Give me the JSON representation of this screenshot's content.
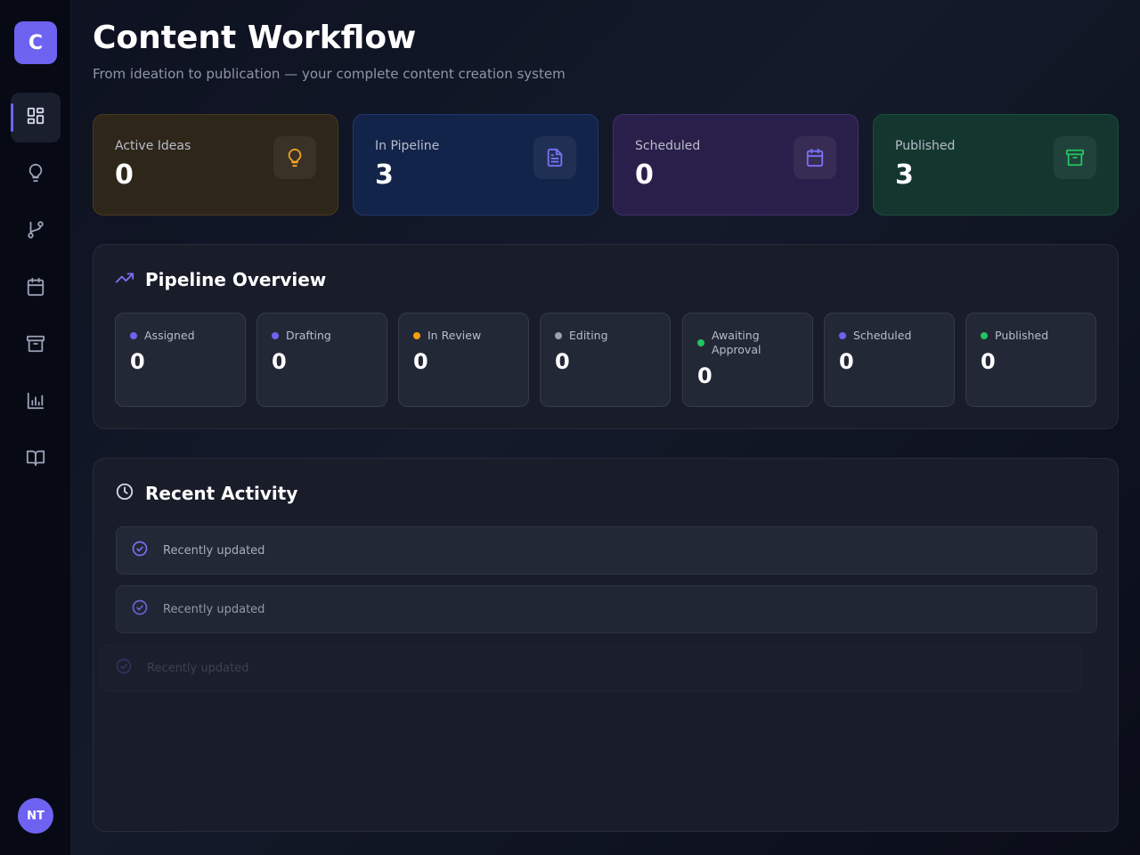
{
  "sidebar": {
    "logo": "C",
    "items": [
      {
        "name": "dashboard",
        "icon": "grid-icon",
        "active": true
      },
      {
        "name": "ideas",
        "icon": "lightbulb-icon"
      },
      {
        "name": "workflow",
        "icon": "git-branch-icon"
      },
      {
        "name": "calendar",
        "icon": "calendar-icon"
      },
      {
        "name": "archive",
        "icon": "archive-icon"
      },
      {
        "name": "analytics",
        "icon": "bar-chart-icon"
      },
      {
        "name": "library",
        "icon": "book-open-icon"
      }
    ],
    "avatar": "NT"
  },
  "header": {
    "title": "Content Workflow",
    "subtitle": "From ideation to publication — your complete content creation system"
  },
  "stats": [
    {
      "label": "Active Ideas",
      "value": "0",
      "icon": "lightbulb-icon",
      "color": "#f5a524"
    },
    {
      "label": "In Pipeline",
      "value": "3",
      "icon": "document-icon",
      "color": "#6e63f0"
    },
    {
      "label": "Scheduled",
      "value": "0",
      "icon": "calendar-icon",
      "color": "#6e63f0"
    },
    {
      "label": "Published",
      "value": "3",
      "icon": "archive-icon",
      "color": "#22c55e"
    }
  ],
  "pipeline": {
    "title": "Pipeline Overview",
    "stages": [
      {
        "label": "Assigned",
        "value": "0",
        "color": "#6e63f0"
      },
      {
        "label": "Drafting",
        "value": "0",
        "color": "#6e63f0"
      },
      {
        "label": "In Review",
        "value": "0",
        "color": "#f59e0b"
      },
      {
        "label": "Editing",
        "value": "0",
        "color": "#9ca3af"
      },
      {
        "label": "Awaiting Approval",
        "value": "0",
        "color": "#22c55e"
      },
      {
        "label": "Scheduled",
        "value": "0",
        "color": "#6e63f0"
      },
      {
        "label": "Published",
        "value": "0",
        "color": "#22c55e"
      }
    ]
  },
  "activity": {
    "title": "Recent Activity",
    "items": [
      {
        "text": "Recently updated"
      },
      {
        "text": "Recently updated"
      },
      {
        "text": "Recently updated"
      }
    ]
  }
}
